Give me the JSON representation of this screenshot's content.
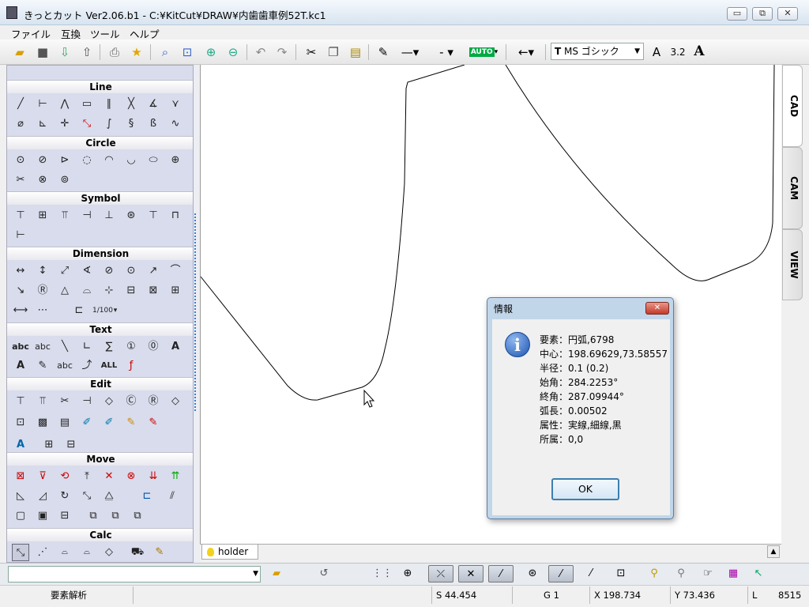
{
  "window": {
    "title": "きっとカット Ver2.06.b1 - C:¥KitCut¥DRAW¥内歯歯車例52T.kc1",
    "minimize": "▭",
    "restore": "⧉",
    "close": "✕"
  },
  "menu": [
    "ファイル",
    "互換",
    "ツール",
    "ヘルプ"
  ],
  "toolbar": {
    "font_name": "MS ゴシック",
    "font_size": "3.2",
    "auto_badge": "AUTO",
    "font_icon_label": "A"
  },
  "palette": {
    "sections": [
      "Line",
      "Circle",
      "Symbol",
      "Dimension",
      "Text",
      "Edit",
      "Move",
      "Calc"
    ]
  },
  "canvas": {
    "tab_label": "holder"
  },
  "side_tabs": [
    "CAD",
    "CAM",
    "VIEW"
  ],
  "dialog": {
    "title": "情報",
    "lines": [
      "要素：円弧,6798",
      "中心：198.69629,73.58557",
      "半径：0.1 (0.2)",
      "始角：284.2253°",
      "終角：287.09944°",
      "弧長：0.00502",
      "属性：実線,細線,黒",
      "所属：0,0"
    ],
    "ok_label": "OK"
  },
  "status": {
    "mode": "要素解析",
    "s": "S 44.454",
    "g": "G 1",
    "x": "X 198.734",
    "y": "Y 73.436",
    "l": "L",
    "l_value": "8515"
  }
}
